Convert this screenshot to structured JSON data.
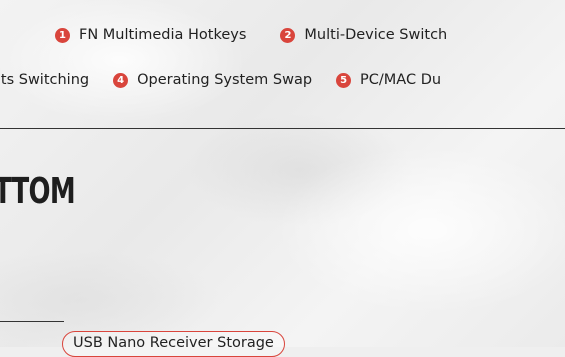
{
  "features": {
    "row1": [
      {
        "num": "1",
        "label": "FN Multimedia Hotkeys"
      },
      {
        "num": "2",
        "label": "Multi-Device Switch"
      }
    ],
    "row2": [
      {
        "num": "",
        "label": "ects Switching"
      },
      {
        "num": "4",
        "label": "Operating System Swap"
      },
      {
        "num": "5",
        "label": "PC/MAC Du"
      }
    ]
  },
  "section": {
    "heading": "TTOM"
  },
  "callout": {
    "label": "USB Nano Receiver Storage"
  },
  "colors": {
    "accent": "#d9453c",
    "text": "#222222",
    "rule": "#333333"
  }
}
